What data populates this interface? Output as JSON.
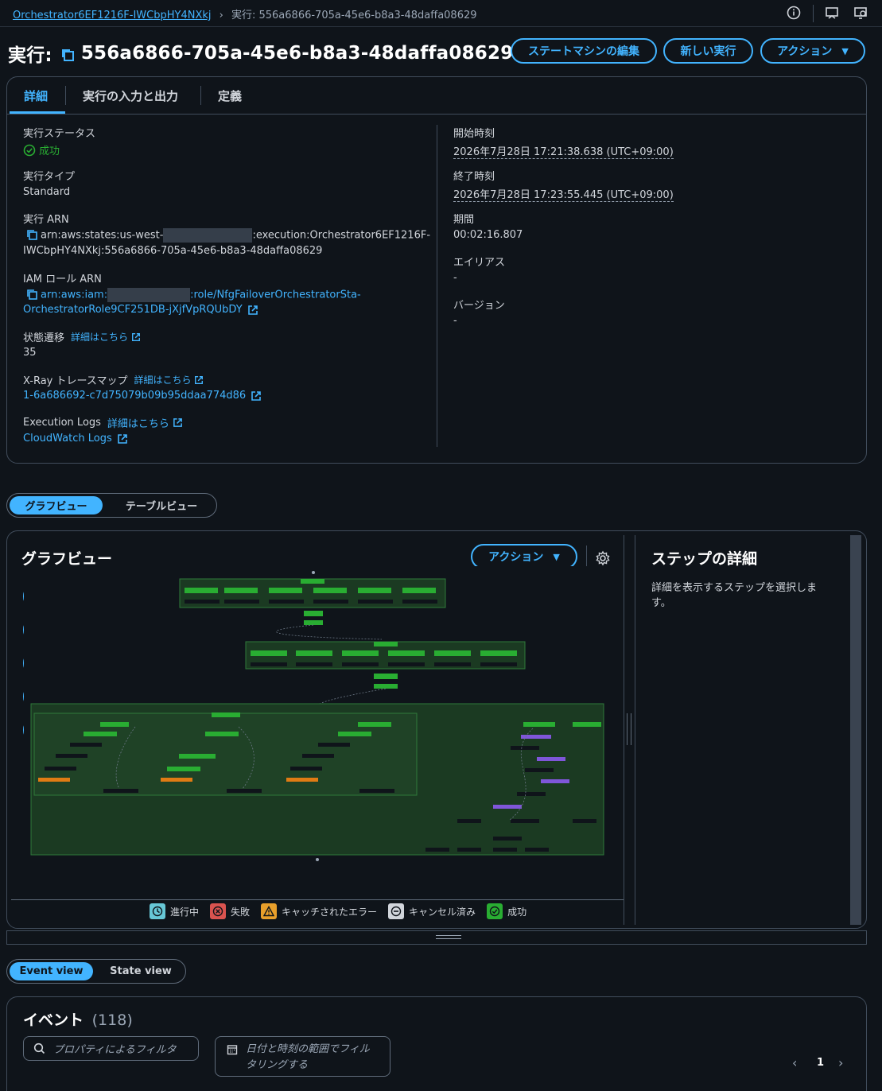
{
  "breadcrumb": {
    "parent": "Orchestrator6EF1216F-IWCbpHY4NXkj",
    "current": "実行: 556a6866-705a-45e6-b8a3-48daffa08629"
  },
  "header": {
    "title_prefix": "実行:",
    "execution_id": "556a6866-705a-45e6-b8a3-48daffa08629",
    "edit_button": "ステートマシンの編集",
    "new_exec_button": "新しい実行",
    "actions_button": "アクション"
  },
  "tabs": [
    "詳細",
    "実行の入力と出力",
    "定義"
  ],
  "details": {
    "status_label": "実行ステータス",
    "status_value": "成功",
    "type_label": "実行タイプ",
    "type_value": "Standard",
    "arn_label": "実行 ARN",
    "arn_part1": "arn:aws:states:us-west-",
    "arn_part2": ":execution:Orchestrator6EF1216F-",
    "arn_part3": "IWCbpHY4NXkj:556a6866-705a-45e6-b8a3-48daffa08629",
    "iam_label": "IAM ロール ARN",
    "iam_part1": "arn:aws:iam:",
    "iam_part2": ":role/NfgFailoverOrchestratorSta-",
    "iam_part3": "OrchestratorRole9CF251DB-jXjfVpRQUbDY",
    "transitions_label": "状態遷移",
    "transitions_link": "詳細はこちら",
    "transitions_value": "35",
    "xray_label": "X-Ray トレースマップ",
    "xray_link": "詳細はこちら",
    "xray_value": "1-6a686692-c7d75079b09b95ddaa774d86",
    "logs_label": "Execution Logs",
    "logs_link": "詳細はこちら",
    "logs_value": "CloudWatch Logs",
    "start_label": "開始時刻",
    "start_value": "2026年7月28日 17:21:38.638 (UTC+09:00)",
    "end_label": "終了時刻",
    "end_value": "2026年7月28日 17:23:55.445 (UTC+09:00)",
    "duration_label": "期間",
    "duration_value": "00:02:16.807",
    "alias_label": "エイリアス",
    "alias_value": "-",
    "version_label": "バージョン",
    "version_value": "-"
  },
  "view_toggle": {
    "graph": "グラフビュー",
    "table": "テーブルビュー"
  },
  "graph": {
    "title": "グラフビュー",
    "actions_button": "アクション",
    "step_title": "ステップの詳細",
    "step_hint": "詳細を表示するステップを選択します。"
  },
  "legend": {
    "in_progress": "進行中",
    "failed": "失敗",
    "caught": "キャッチされたエラー",
    "cancelled": "キャンセル済み",
    "succeeded": "成功"
  },
  "event_toggle": {
    "event": "Event view",
    "state": "State view"
  },
  "events": {
    "title": "イベント",
    "count": "(118)",
    "filter_placeholder": "プロパティによるフィルタ",
    "date_filter_line1": "日付と時刻の範囲でフィル",
    "date_filter_line2": "タリングする",
    "page": "1"
  },
  "colors": {
    "accent": "#42b4ff",
    "success": "#29ad32",
    "background": "#0f141a"
  }
}
